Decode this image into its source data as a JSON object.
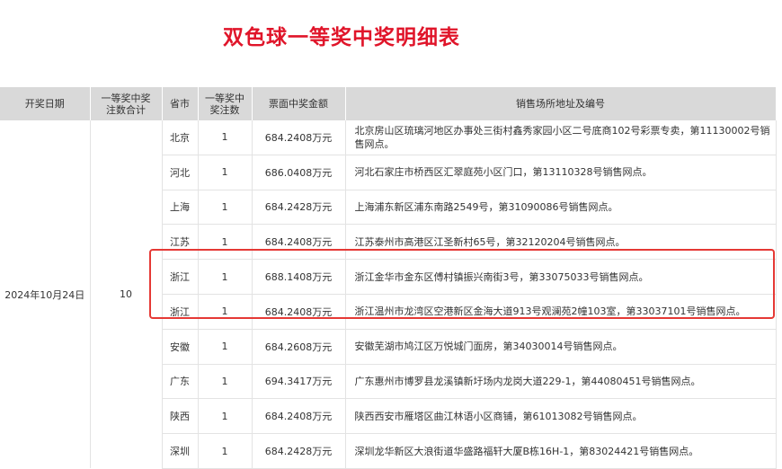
{
  "title": "双色球一等奖中奖明细表",
  "headers": {
    "date": "开奖日期",
    "total": "一等奖中奖注数合计",
    "province": "省市",
    "count": "一等奖中奖注数",
    "amount": "票面中奖金额",
    "address": "销售场所地址及编号"
  },
  "date": "2024年10月24日",
  "total": "10",
  "rows": [
    {
      "province": "北京",
      "count": "1",
      "amount": "684.2408万元",
      "address": "北京房山区琉璃河地区办事处三街村鑫秀家园小区二号底商102号彩票专卖，第11130002号销售网点。"
    },
    {
      "province": "河北",
      "count": "1",
      "amount": "686.0408万元",
      "address": "河北石家庄市桥西区汇翠庭苑小区门口，第13110328号销售网点。"
    },
    {
      "province": "上海",
      "count": "1",
      "amount": "684.2428万元",
      "address": "上海浦东新区浦东南路2549号，第31090086号销售网点。"
    },
    {
      "province": "江苏",
      "count": "1",
      "amount": "684.2408万元",
      "address": "江苏泰州市高港区江圣新村65号，第32120204号销售网点。"
    },
    {
      "province": "浙江",
      "count": "1",
      "amount": "688.1408万元",
      "address": "浙江金华市金东区傅村镇振兴南街3号，第33075033号销售网点。"
    },
    {
      "province": "浙江",
      "count": "1",
      "amount": "684.2408万元",
      "address": "浙江温州市龙湾区空港新区金海大道913号观澜苑2幢103室，第33037101号销售网点。"
    },
    {
      "province": "安徽",
      "count": "1",
      "amount": "684.2608万元",
      "address": "安徽芜湖市鸠江区万悦城门面房，第34030014号销售网点。"
    },
    {
      "province": "广东",
      "count": "1",
      "amount": "694.3417万元",
      "address": "广东惠州市博罗县龙溪镇新圩场内龙岗大道229-1，第44080451号销售网点。"
    },
    {
      "province": "陕西",
      "count": "1",
      "amount": "684.2408万元",
      "address": "陕西西安市雁塔区曲江林语小区商铺，第61013082号销售网点。"
    },
    {
      "province": "深圳",
      "count": "1",
      "amount": "684.2428万元",
      "address": "深圳龙华新区大浪街道华盛路福轩大厦B栋16H-1，第83024421号销售网点。"
    }
  ],
  "highlight_color": "#e53935",
  "title_color": "#e0152a"
}
